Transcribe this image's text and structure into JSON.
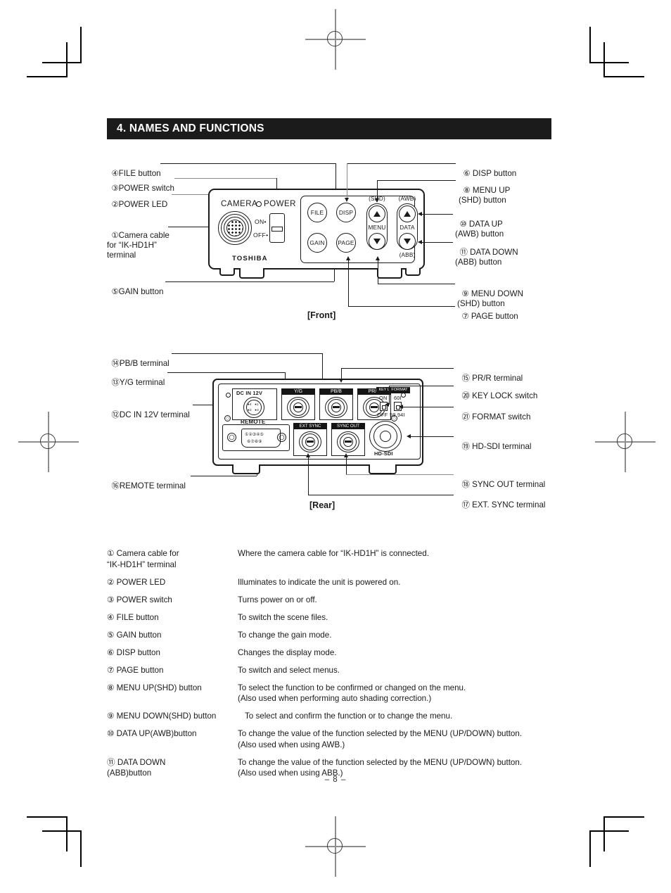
{
  "page": {
    "section_title": "4.  NAMES AND FUNCTIONS",
    "page_number": "–  8  –"
  },
  "front_diagram": {
    "caption": "[Front]",
    "panel_text": {
      "camera": "CAMERA",
      "power": "POWER",
      "on": "ON•",
      "off": "OFF•",
      "brand": "TOSHIBA"
    },
    "buttons": [
      {
        "name": "file-button",
        "label": "FILE"
      },
      {
        "name": "disp-button",
        "label": "DISP"
      },
      {
        "name": "gain-button",
        "label": "GAIN"
      },
      {
        "name": "page-button",
        "label": "PAGE"
      }
    ],
    "pads": {
      "menu": {
        "top_cap": "(SHD)",
        "mid_cap": "MENU",
        "bottom_cap": ""
      },
      "data": {
        "top_cap": "(AWB)",
        "mid_cap": "DATA",
        "bottom_cap": "(ABB)"
      }
    },
    "callouts_left": [
      {
        "num": "④",
        "text": "FILE button"
      },
      {
        "num": "③",
        "text": "POWER switch"
      },
      {
        "num": "②",
        "text": "POWER LED"
      },
      {
        "num": "①",
        "text": "Camera cable\nfor “IK-HD1H”\nterminal"
      },
      {
        "num": "⑤",
        "text": "GAIN button"
      }
    ],
    "callouts_right": [
      {
        "num": "⑥",
        "text": "DISP button"
      },
      {
        "num": "⑧",
        "text": "MENU UP\n(SHD) button"
      },
      {
        "num": "⑩",
        "text": "DATA UP\n(AWB) button"
      },
      {
        "num": "⑪",
        "text": "DATA DOWN\n(ABB) button"
      },
      {
        "num": "⑨",
        "text": "MENU DOWN\n(SHD) button"
      },
      {
        "num": "⑦",
        "text": "PAGE button"
      }
    ]
  },
  "rear_diagram": {
    "caption": "[Rear]",
    "panel_text": {
      "dc_in": "DC IN 12V",
      "yg": "Y/G",
      "pbb": "PB/B",
      "prr": "PR/R",
      "key_lock": "KEY LOCK",
      "format": "FORMAT",
      "sw_on": "ON",
      "sw_off": "OFF",
      "fmt_60i": "60I",
      "fmt_5994i": "59.94I",
      "remote": "REMOTE",
      "ext_sync": "EXT SYNC",
      "sync_out": "SYNC OUT",
      "hd_sdi": "HD-SDI",
      "dsub_pins_top": "①②③④⑤",
      "dsub_pins_bottom": "⑥⑦⑧⑨",
      "dc_pin_labels": "●4   ●1\n●2   ●3"
    },
    "callouts_left": [
      {
        "num": "⑭",
        "text": "PB/B terminal"
      },
      {
        "num": "⑬",
        "text": "Y/G terminal"
      },
      {
        "num": "⑫",
        "text": "DC IN 12V terminal"
      },
      {
        "num": "⑯",
        "text": "REMOTE terminal"
      }
    ],
    "callouts_right": [
      {
        "num": "⑮",
        "text": "PR/R terminal"
      },
      {
        "num": "⑳",
        "text": "KEY LOCK switch"
      },
      {
        "num": "㉑",
        "text": "FORMAT switch"
      },
      {
        "num": "⑲",
        "text": "HD-SDI terminal"
      },
      {
        "num": "⑱",
        "text": "SYNC OUT terminal"
      },
      {
        "num": "⑰",
        "text": "EXT. SYNC terminal"
      }
    ]
  },
  "descriptions": [
    {
      "num": "①",
      "term": "Camera cable for\n    “IK-HD1H” terminal",
      "desc": "Where the camera cable for “IK-HD1H” is connected."
    },
    {
      "num": "②",
      "term": "POWER LED",
      "desc": "Illuminates to indicate the unit is powered on."
    },
    {
      "num": "③",
      "term": "POWER switch",
      "desc": "Turns power on or off."
    },
    {
      "num": "④",
      "term": "FILE button",
      "desc": "To switch the scene files."
    },
    {
      "num": "⑤",
      "term": "GAIN button",
      "desc": "To change the gain mode."
    },
    {
      "num": "⑥",
      "term": "DISP button",
      "desc": "Changes the display mode."
    },
    {
      "num": "⑦",
      "term": "PAGE button",
      "desc": "To switch and select menus."
    },
    {
      "num": "⑧",
      "term": "MENU UP(SHD) button",
      "desc": "To select the function to be confirmed or changed on the menu.\n(Also used when performing auto shading correction.)"
    },
    {
      "num": "⑨",
      "term": "MENU DOWN(SHD) button",
      "desc": "To select and confirm the function or to change the menu."
    },
    {
      "num": "⑩",
      "term": "DATA UP(AWB)button",
      "desc": "To change the value of the function selected by the MENU (UP/DOWN) button.\n(Also used when using AWB.)"
    },
    {
      "num": "⑪",
      "term": "DATA DOWN\n  (ABB)button",
      "desc": "To change the value of the function selected by the MENU (UP/DOWN) button.\n(Also used when using ABB.)"
    }
  ]
}
